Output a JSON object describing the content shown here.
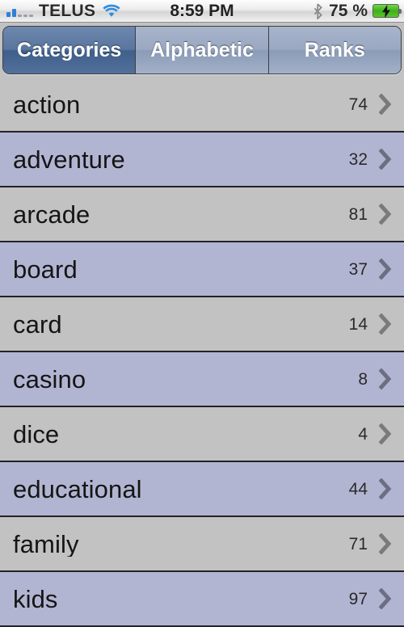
{
  "statusbar": {
    "signal_icon": "signal-bars-icon",
    "signal_bars_filled": 2,
    "signal_bars_total": 5,
    "carrier": "TELUS",
    "wifi_icon": "wifi-icon",
    "time": "8:59 PM",
    "bluetooth_icon": "bluetooth-icon",
    "battery_percent": "75 %",
    "battery_icon": "battery-charging-icon",
    "battery_color": "#4bb81e"
  },
  "segmented_control": {
    "selected_index": 0,
    "selected_color": "#4a6a96",
    "unselected_color": "#9aa8c2",
    "segments": [
      {
        "label": "Categories"
      },
      {
        "label": "Alphabetic"
      },
      {
        "label": "Ranks"
      }
    ]
  },
  "list": {
    "row_color_odd": "#c2c2c2",
    "row_color_even": "#b2b5d2",
    "disclosure_icon": "chevron-right-icon",
    "rows": [
      {
        "label": "action",
        "count": "74"
      },
      {
        "label": "adventure",
        "count": "32"
      },
      {
        "label": "arcade",
        "count": "81"
      },
      {
        "label": "board",
        "count": "37"
      },
      {
        "label": "card",
        "count": "14"
      },
      {
        "label": "casino",
        "count": "8"
      },
      {
        "label": "dice",
        "count": "4"
      },
      {
        "label": "educational",
        "count": "44"
      },
      {
        "label": "family",
        "count": "71"
      },
      {
        "label": "kids",
        "count": "97"
      }
    ]
  }
}
